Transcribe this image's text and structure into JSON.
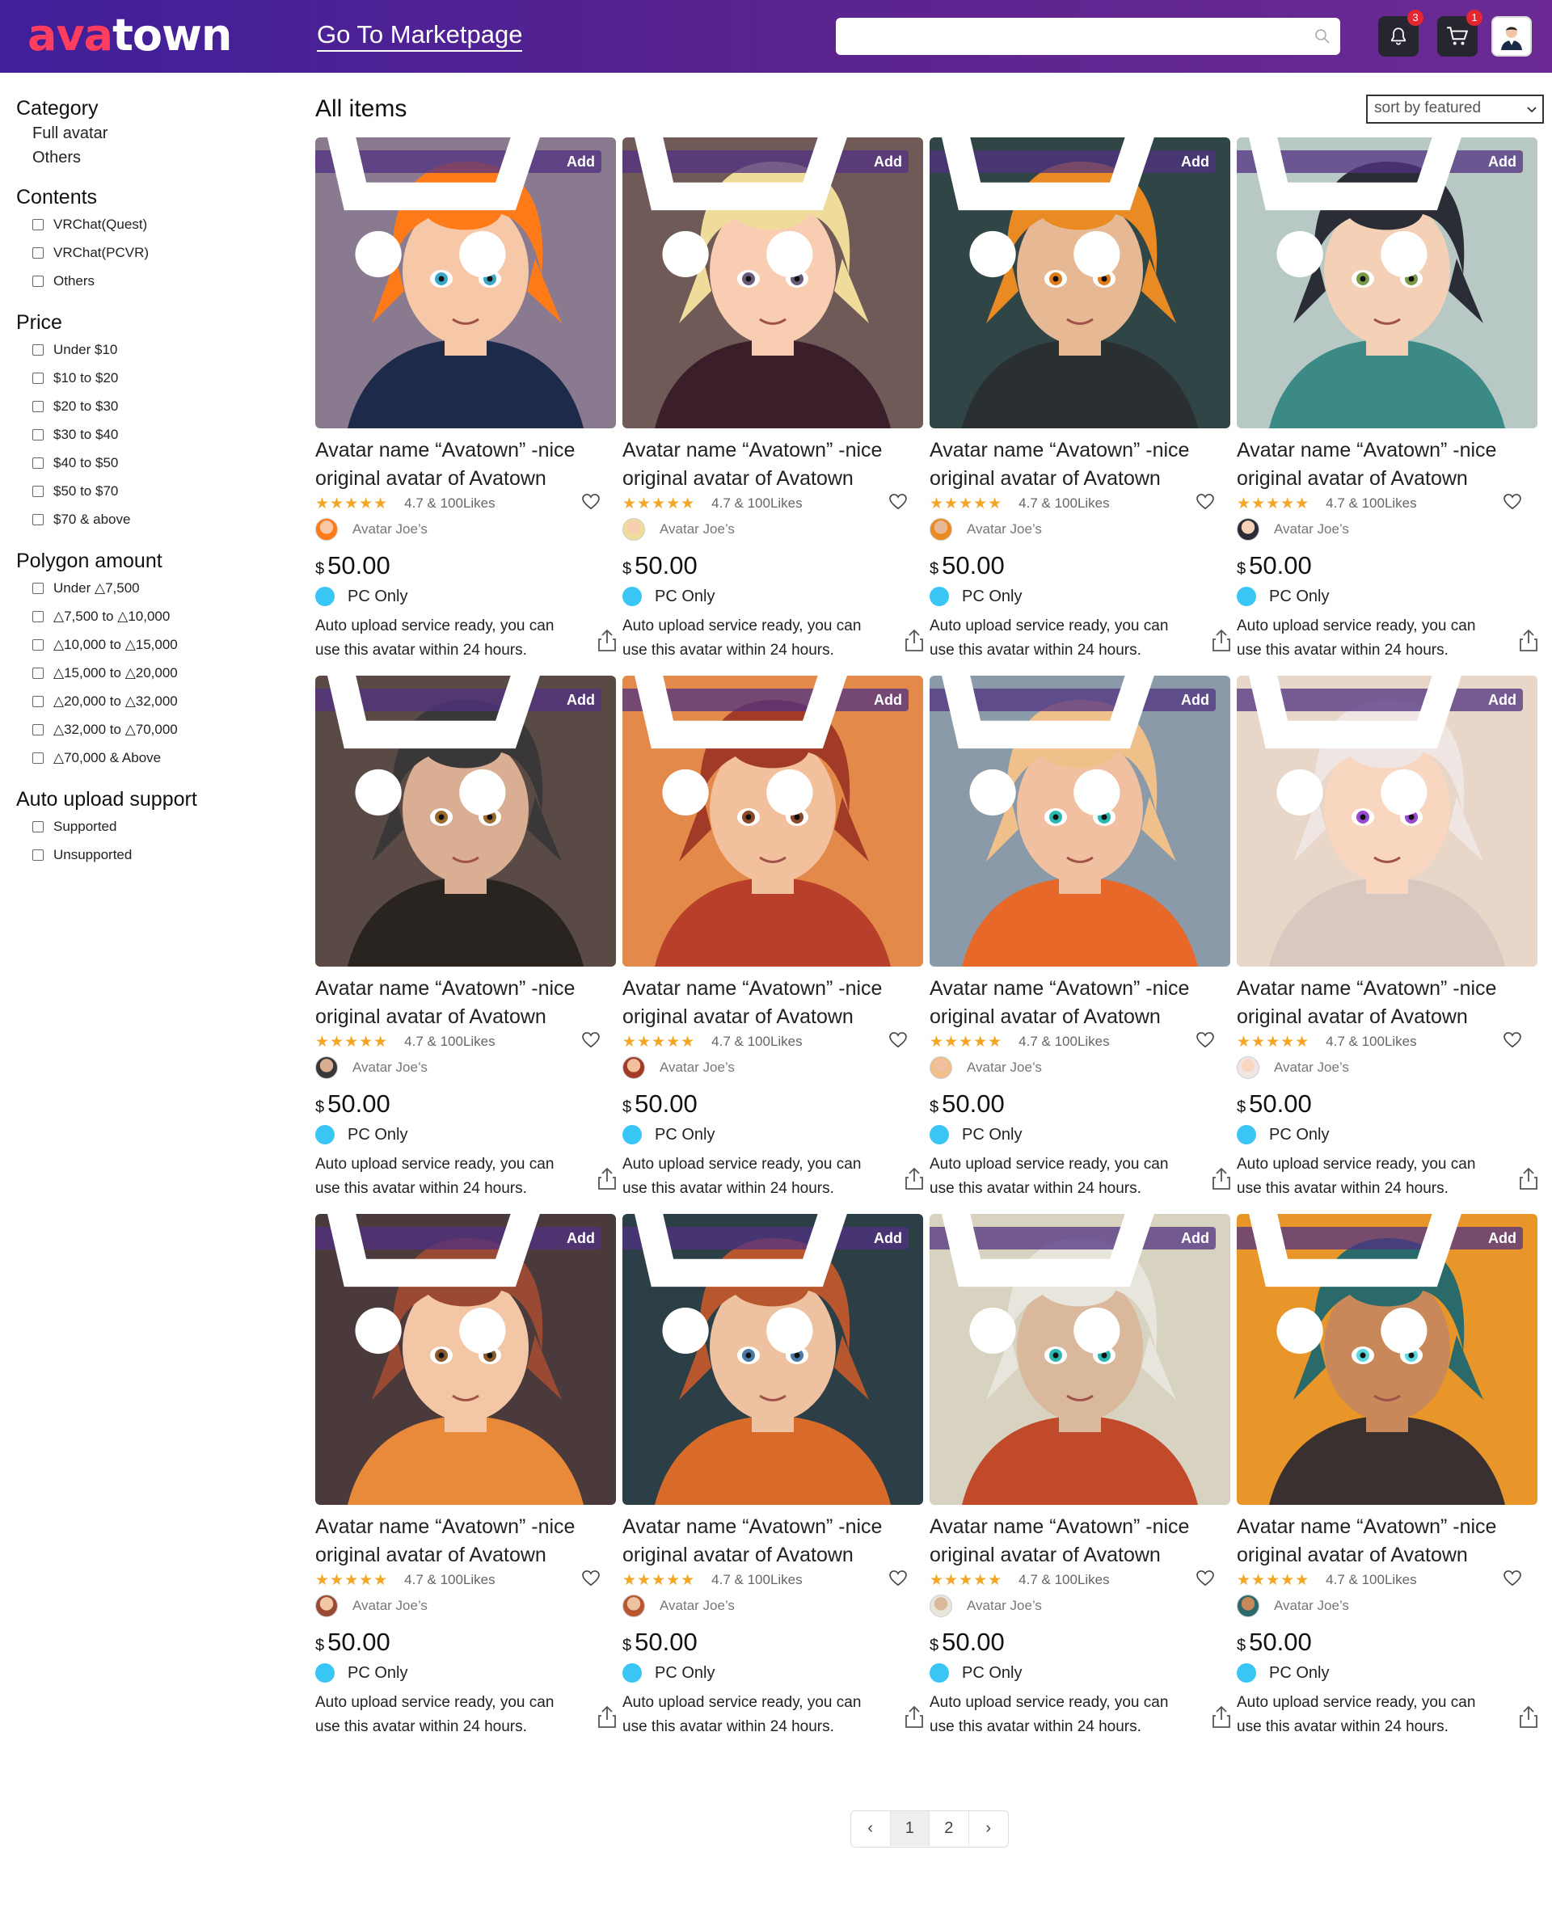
{
  "header": {
    "logo_part1": "ava",
    "logo_part2": "town",
    "nav_link": "Go To Marketpage",
    "search_placeholder": "",
    "notifications_count": "3",
    "cart_count": "1",
    "icons": [
      "search-icon",
      "bell-icon",
      "cart-icon",
      "user-avatar"
    ]
  },
  "sidebar": {
    "category_title": "Category",
    "category_items": [
      "Full avatar",
      "Others"
    ],
    "contents_title": "Contents",
    "contents_items": [
      "VRChat(Quest)",
      "VRChat(PCVR)",
      "Others"
    ],
    "price_title": "Price",
    "price_items": [
      "Under $10",
      "$10 to $20",
      "$20 to $30",
      "$30 to $40",
      "$40 to $50",
      "$50 to $70",
      "$70 & above"
    ],
    "polygon_title": "Polygon amount",
    "polygon_items": [
      "Under △7,500",
      "△7,500 to △10,000",
      "△10,000 to △15,000",
      "△15,000 to △20,000",
      "△20,000 to △32,000",
      "△32,000 to △70,000",
      "△70,000 & Above"
    ],
    "auto_title": "Auto upload support",
    "auto_items": [
      "Supported",
      "Unsupported"
    ]
  },
  "main": {
    "title": "All items",
    "sort_value": "sort by featured"
  },
  "product_common": {
    "add_label": "Add",
    "title": "Avatar name “Avatown” -nice original avatar of Avatown",
    "stars": "★★★★★",
    "rating_text": "4.7 & 100Likes",
    "creator": "Avatar Joe’s",
    "currency": "$",
    "price": "50.00",
    "platform": "PC Only",
    "description": "Auto upload service ready, you can use this avatar within 24 hours."
  },
  "products": [
    {
      "bg": "#8a7a90",
      "hair": "#ff7a18",
      "skin": "#f6c8a8",
      "cloth": "#1d2a4a",
      "eyes": "#3aa6c8"
    },
    {
      "bg": "#6f5a58",
      "hair": "#f0dc9a",
      "skin": "#f8cdb2",
      "cloth": "#3a1f2a",
      "eyes": "#6a5a7a"
    },
    {
      "bg": "#2f4546",
      "hair": "#ea8a22",
      "skin": "#e7b894",
      "cloth": "#2a2f32",
      "eyes": "#e07a1a"
    },
    {
      "bg": "#b8c8c4",
      "hair": "#2a2d35",
      "skin": "#f3d0b6",
      "cloth": "#3b8a86",
      "eyes": "#7a9a4a"
    },
    {
      "bg": "#5a4a46",
      "hair": "#3a3738",
      "skin": "#d9ae92",
      "cloth": "#2a2420",
      "eyes": "#9a6a2a"
    },
    {
      "bg": "#e38a4a",
      "hair": "#a23a28",
      "skin": "#f3c09e",
      "cloth": "#b8402a",
      "eyes": "#8a4a2a"
    },
    {
      "bg": "#8a9aa8",
      "hair": "#f0c08a",
      "skin": "#f0c0a0",
      "cloth": "#e8682a",
      "eyes": "#2ab8b0"
    },
    {
      "bg": "#e8d6c8",
      "hair": "#efe6e4",
      "skin": "#f8d6c0",
      "cloth": "#d8c8c0",
      "eyes": "#9a4ad0"
    },
    {
      "bg": "#4a3a3c",
      "hair": "#9a4a32",
      "skin": "#f3c6a6",
      "cloth": "#e88a3a",
      "eyes": "#8a5a2a"
    },
    {
      "bg": "#2c3e46",
      "hair": "#b8572e",
      "skin": "#eec2a0",
      "cloth": "#d86a2a",
      "eyes": "#4a7aa8"
    },
    {
      "bg": "#d8d2c0",
      "hair": "#e8e6dc",
      "skin": "#d9b89c",
      "cloth": "#c04a2a",
      "eyes": "#2ab8b0"
    },
    {
      "bg": "#e8962a",
      "hair": "#2a6a6a",
      "skin": "#c8885a",
      "cloth": "#3a3030",
      "eyes": "#5ad8e0"
    }
  ],
  "pagination": {
    "prev": "‹",
    "pages": [
      "1",
      "2"
    ],
    "next": "›"
  }
}
